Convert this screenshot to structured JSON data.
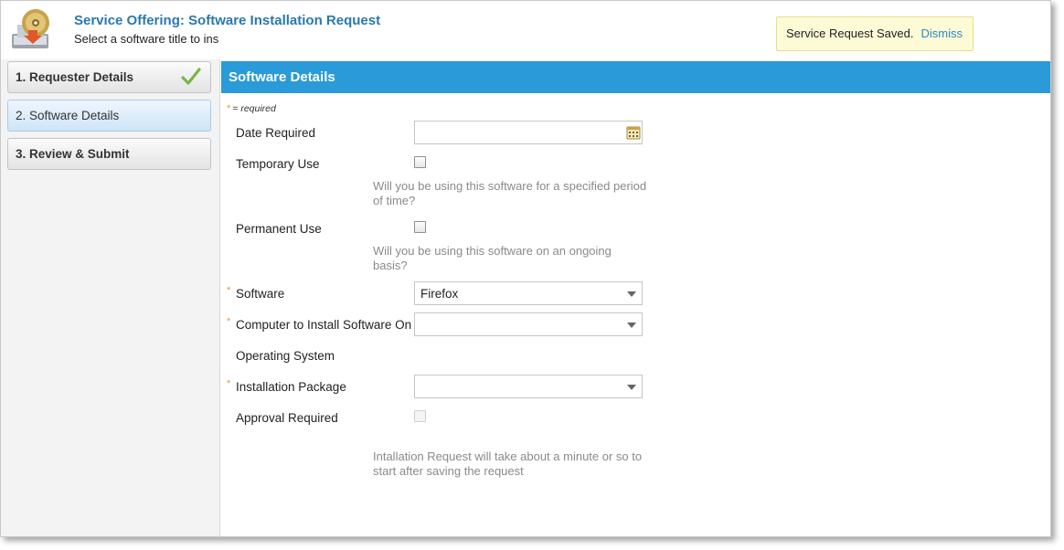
{
  "header": {
    "title": "Service Offering: Software Installation Request",
    "subtitle": "Select a software title to ins",
    "app_icon": "software-install-icon"
  },
  "notice": {
    "message": "Service Request Saved.",
    "dismiss_label": "Dismiss"
  },
  "steps": [
    {
      "label": "1. Requester Details",
      "state": "completed"
    },
    {
      "label": "2. Software Details",
      "state": "active"
    },
    {
      "label": "3. Review & Submit",
      "state": "pending"
    }
  ],
  "section": {
    "title": "Software Details",
    "required_star": "*",
    "required_note": "= required"
  },
  "form": {
    "date_required": {
      "label": "Date Required",
      "value": ""
    },
    "temporary_use": {
      "label": "Temporary Use",
      "checked": false,
      "help": "Will you be using this software for a specified period of time?"
    },
    "permanent_use": {
      "label": "Permanent Use",
      "checked": false,
      "help": "Will you be using this software on an ongoing basis?"
    },
    "software": {
      "label": "Software",
      "value": "Firefox",
      "required": true
    },
    "computer": {
      "label": "Computer to Install Software On",
      "value": "",
      "required": true
    },
    "operating_system": {
      "label": "Operating System"
    },
    "installation_package": {
      "label": "Installation Package",
      "value": "",
      "required": true
    },
    "approval_required": {
      "label": "Approval Required",
      "checked": false,
      "disabled": true
    },
    "install_note": "Intallation Request will take about a minute or so to start after saving the request"
  },
  "colors": {
    "accent": "#2a9ad8",
    "title": "#2a78b0",
    "required_star": "#e39b3a",
    "check_green": "#7ab648"
  }
}
